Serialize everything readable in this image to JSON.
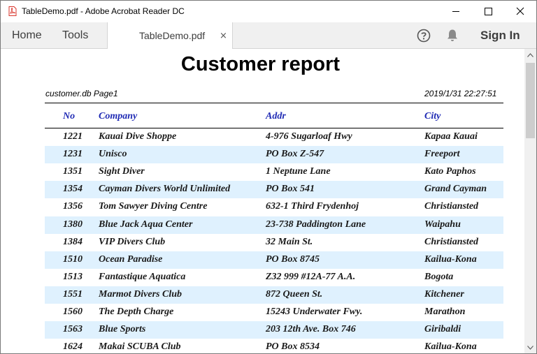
{
  "window": {
    "title": "TableDemo.pdf - Adobe Acrobat Reader DC"
  },
  "toolbar": {
    "home_label": "Home",
    "tools_label": "Tools",
    "tab_label": "TableDemo.pdf",
    "tab_close": "×",
    "signin_label": "Sign In"
  },
  "report": {
    "title": "Customer report",
    "meta_left": "customer.db  Page1",
    "meta_right": "2019/1/31 22:27:51",
    "columns": [
      "No",
      "Company",
      "Addr",
      "City"
    ],
    "rows": [
      {
        "no": "1221",
        "company": "Kauai Dive Shoppe",
        "addr": "4-976 Sugarloaf Hwy",
        "city": "Kapaa Kauai"
      },
      {
        "no": "1231",
        "company": "Unisco",
        "addr": "PO Box Z-547",
        "city": "Freeport"
      },
      {
        "no": "1351",
        "company": "Sight Diver",
        "addr": "1 Neptune Lane",
        "city": "Kato Paphos"
      },
      {
        "no": "1354",
        "company": "Cayman Divers World Unlimited",
        "addr": "PO Box 541",
        "city": "Grand Cayman"
      },
      {
        "no": "1356",
        "company": "Tom Sawyer Diving Centre",
        "addr": "632-1 Third Frydenhoj",
        "city": "Christiansted"
      },
      {
        "no": "1380",
        "company": "Blue Jack Aqua Center",
        "addr": "23-738 Paddington Lane",
        "city": "Waipahu"
      },
      {
        "no": "1384",
        "company": "VIP Divers Club",
        "addr": "32 Main St.",
        "city": "Christiansted"
      },
      {
        "no": "1510",
        "company": "Ocean Paradise",
        "addr": "PO Box 8745",
        "city": "Kailua-Kona"
      },
      {
        "no": "1513",
        "company": "Fantastique Aquatica",
        "addr": "Z32 999 #12A-77 A.A.",
        "city": "Bogota"
      },
      {
        "no": "1551",
        "company": "Marmot Divers Club",
        "addr": "872 Queen St.",
        "city": "Kitchener"
      },
      {
        "no": "1560",
        "company": "The Depth Charge",
        "addr": "15243 Underwater Fwy.",
        "city": "Marathon"
      },
      {
        "no": "1563",
        "company": "Blue Sports",
        "addr": "203 12th Ave. Box 746",
        "city": "Giribaldi"
      },
      {
        "no": "1624",
        "company": "Makai SCUBA Club",
        "addr": "PO Box 8534",
        "city": "Kailua-Kona"
      }
    ]
  },
  "colors": {
    "header_text": "#1f2ab4",
    "row_shade": "#dff1fe",
    "acrobat_red": "#d9342b"
  },
  "icons": {
    "app": "pdf-document-icon",
    "minimize": "minimize-icon",
    "maximize": "maximize-icon",
    "close": "close-icon",
    "help": "help-icon",
    "notifications": "bell-icon",
    "scroll_up": "chevron-up-icon",
    "scroll_down": "chevron-down-icon"
  }
}
